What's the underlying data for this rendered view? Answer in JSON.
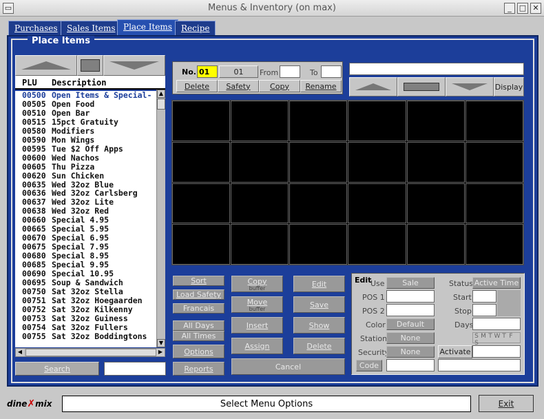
{
  "window": {
    "title": "Menus & Inventory (on max)"
  },
  "tabs": [
    "Purchases",
    "Sales Items",
    "Place Items",
    "Recipe"
  ],
  "panel": {
    "title": "Place Items"
  },
  "list": {
    "col_plu": "PLU",
    "col_desc": "Description",
    "rows": [
      [
        "00500",
        "Open Items & Special-"
      ],
      [
        "00505",
        "Open Food"
      ],
      [
        "00510",
        "Open Bar"
      ],
      [
        "00515",
        "15pct Gratuity"
      ],
      [
        "00580",
        "Modifiers"
      ],
      [
        "00590",
        "Mon Wings"
      ],
      [
        "00595",
        "Tue $2 Off Apps"
      ],
      [
        "00600",
        "Wed Nachos"
      ],
      [
        "00605",
        "Thu Pizza"
      ],
      [
        "00620",
        "Sun Chicken"
      ],
      [
        "00635",
        "Wed 32oz Blue"
      ],
      [
        "00636",
        "Wed 32oz Carlsberg"
      ],
      [
        "00637",
        "Wed 32oz Lite"
      ],
      [
        "00638",
        "Wed 32oz Red"
      ],
      [
        "00660",
        "Special 4.95"
      ],
      [
        "00665",
        "Special 5.95"
      ],
      [
        "00670",
        "Special 6.95"
      ],
      [
        "00675",
        "Special 7.95"
      ],
      [
        "00680",
        "Special 8.95"
      ],
      [
        "00685",
        "Special 9.95"
      ],
      [
        "00690",
        "Special 10.95"
      ],
      [
        "00695",
        "Soup & Sandwich"
      ],
      [
        "00750",
        "Sat 32oz Stella"
      ],
      [
        "00751",
        "Sat 32oz Hoegaarden"
      ],
      [
        "00752",
        "Sat 32oz Kilkenny"
      ],
      [
        "00753",
        "Sat 32oz Guiness"
      ],
      [
        "00754",
        "Sat 32oz Fullers"
      ],
      [
        "00755",
        "Sat 32oz Boddingtons"
      ]
    ]
  },
  "search": {
    "label": "Search",
    "value": ""
  },
  "top": {
    "no_label": "No.",
    "no_value": "01",
    "no_value2": "01",
    "from_label": "From",
    "to_label": "To",
    "delete": "Delete",
    "safety": "Safety",
    "copy": "Copy",
    "rename": "Rename",
    "display": "Display"
  },
  "buttons": {
    "sort": "Sort",
    "load_safety": "Load Safety",
    "francais": "Francais",
    "all_days": "All Days",
    "all_times": "All Times",
    "options": "Options",
    "reports": "Reports",
    "copy_buffer": "Copy",
    "buffer1": "buffer",
    "move_buffer": "Move",
    "buffer2": "buffer",
    "insert": "Insert",
    "assign": "Assign",
    "edit": "Edit",
    "save": "Save",
    "show": "Show",
    "delete": "Delete",
    "cancel": "Cancel"
  },
  "edit": {
    "title": "Edit",
    "use": "Use",
    "sale": "Sale",
    "pos1": "POS 1",
    "pos2": "POS 2",
    "color": "Color",
    "default": "Default",
    "station": "Station",
    "none1": "None",
    "security": "Security",
    "none2": "None",
    "code": "Code",
    "status": "Status",
    "active_time": "Active Time",
    "start": "Start",
    "stop": "Stop",
    "days": "Days",
    "days_letters": [
      "S",
      "M",
      "T",
      "W",
      "T",
      "F",
      "S"
    ],
    "activate": "Activate"
  },
  "footer": {
    "logo_a": "dine",
    "logo_b": "mix",
    "status": "Select Menu Options",
    "exit": "Exit"
  }
}
